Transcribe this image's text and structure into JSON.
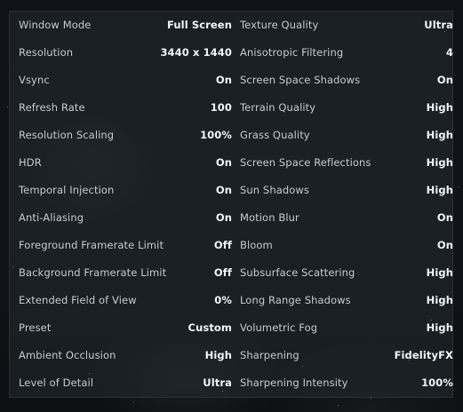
{
  "settings": {
    "left": [
      {
        "label": "Window Mode",
        "value": "Full Screen"
      },
      {
        "label": "Resolution",
        "value": "3440 x 1440"
      },
      {
        "label": "Vsync",
        "value": "On"
      },
      {
        "label": "Refresh Rate",
        "value": "100"
      },
      {
        "label": "Resolution Scaling",
        "value": "100%"
      },
      {
        "label": "HDR",
        "value": "On"
      },
      {
        "label": "Temporal Injection",
        "value": "On"
      },
      {
        "label": "Anti-Aliasing",
        "value": "On"
      },
      {
        "label": "Foreground Framerate Limit",
        "value": "Off"
      },
      {
        "label": "Background Framerate Limit",
        "value": "Off"
      },
      {
        "label": "Extended Field of View",
        "value": "0%"
      },
      {
        "label": "Preset",
        "value": "Custom"
      },
      {
        "label": "Ambient Occlusion",
        "value": "High"
      },
      {
        "label": "Level of Detail",
        "value": "Ultra"
      }
    ],
    "right": [
      {
        "label": "Texture Quality",
        "value": "Ultra"
      },
      {
        "label": "Anisotropic Filtering",
        "value": "4"
      },
      {
        "label": "Screen Space Shadows",
        "value": "On"
      },
      {
        "label": "Terrain Quality",
        "value": "High"
      },
      {
        "label": "Grass Quality",
        "value": "High"
      },
      {
        "label": "Screen Space Reflections",
        "value": "High"
      },
      {
        "label": "Sun Shadows",
        "value": "High"
      },
      {
        "label": "Motion Blur",
        "value": "On"
      },
      {
        "label": "Bloom",
        "value": "On"
      },
      {
        "label": "Subsurface Scattering",
        "value": "High"
      },
      {
        "label": "Long Range Shadows",
        "value": "High"
      },
      {
        "label": "Volumetric Fog",
        "value": "High"
      },
      {
        "label": "Sharpening",
        "value": "FidelityFX"
      },
      {
        "label": "Sharpening Intensity",
        "value": "100%"
      }
    ]
  }
}
